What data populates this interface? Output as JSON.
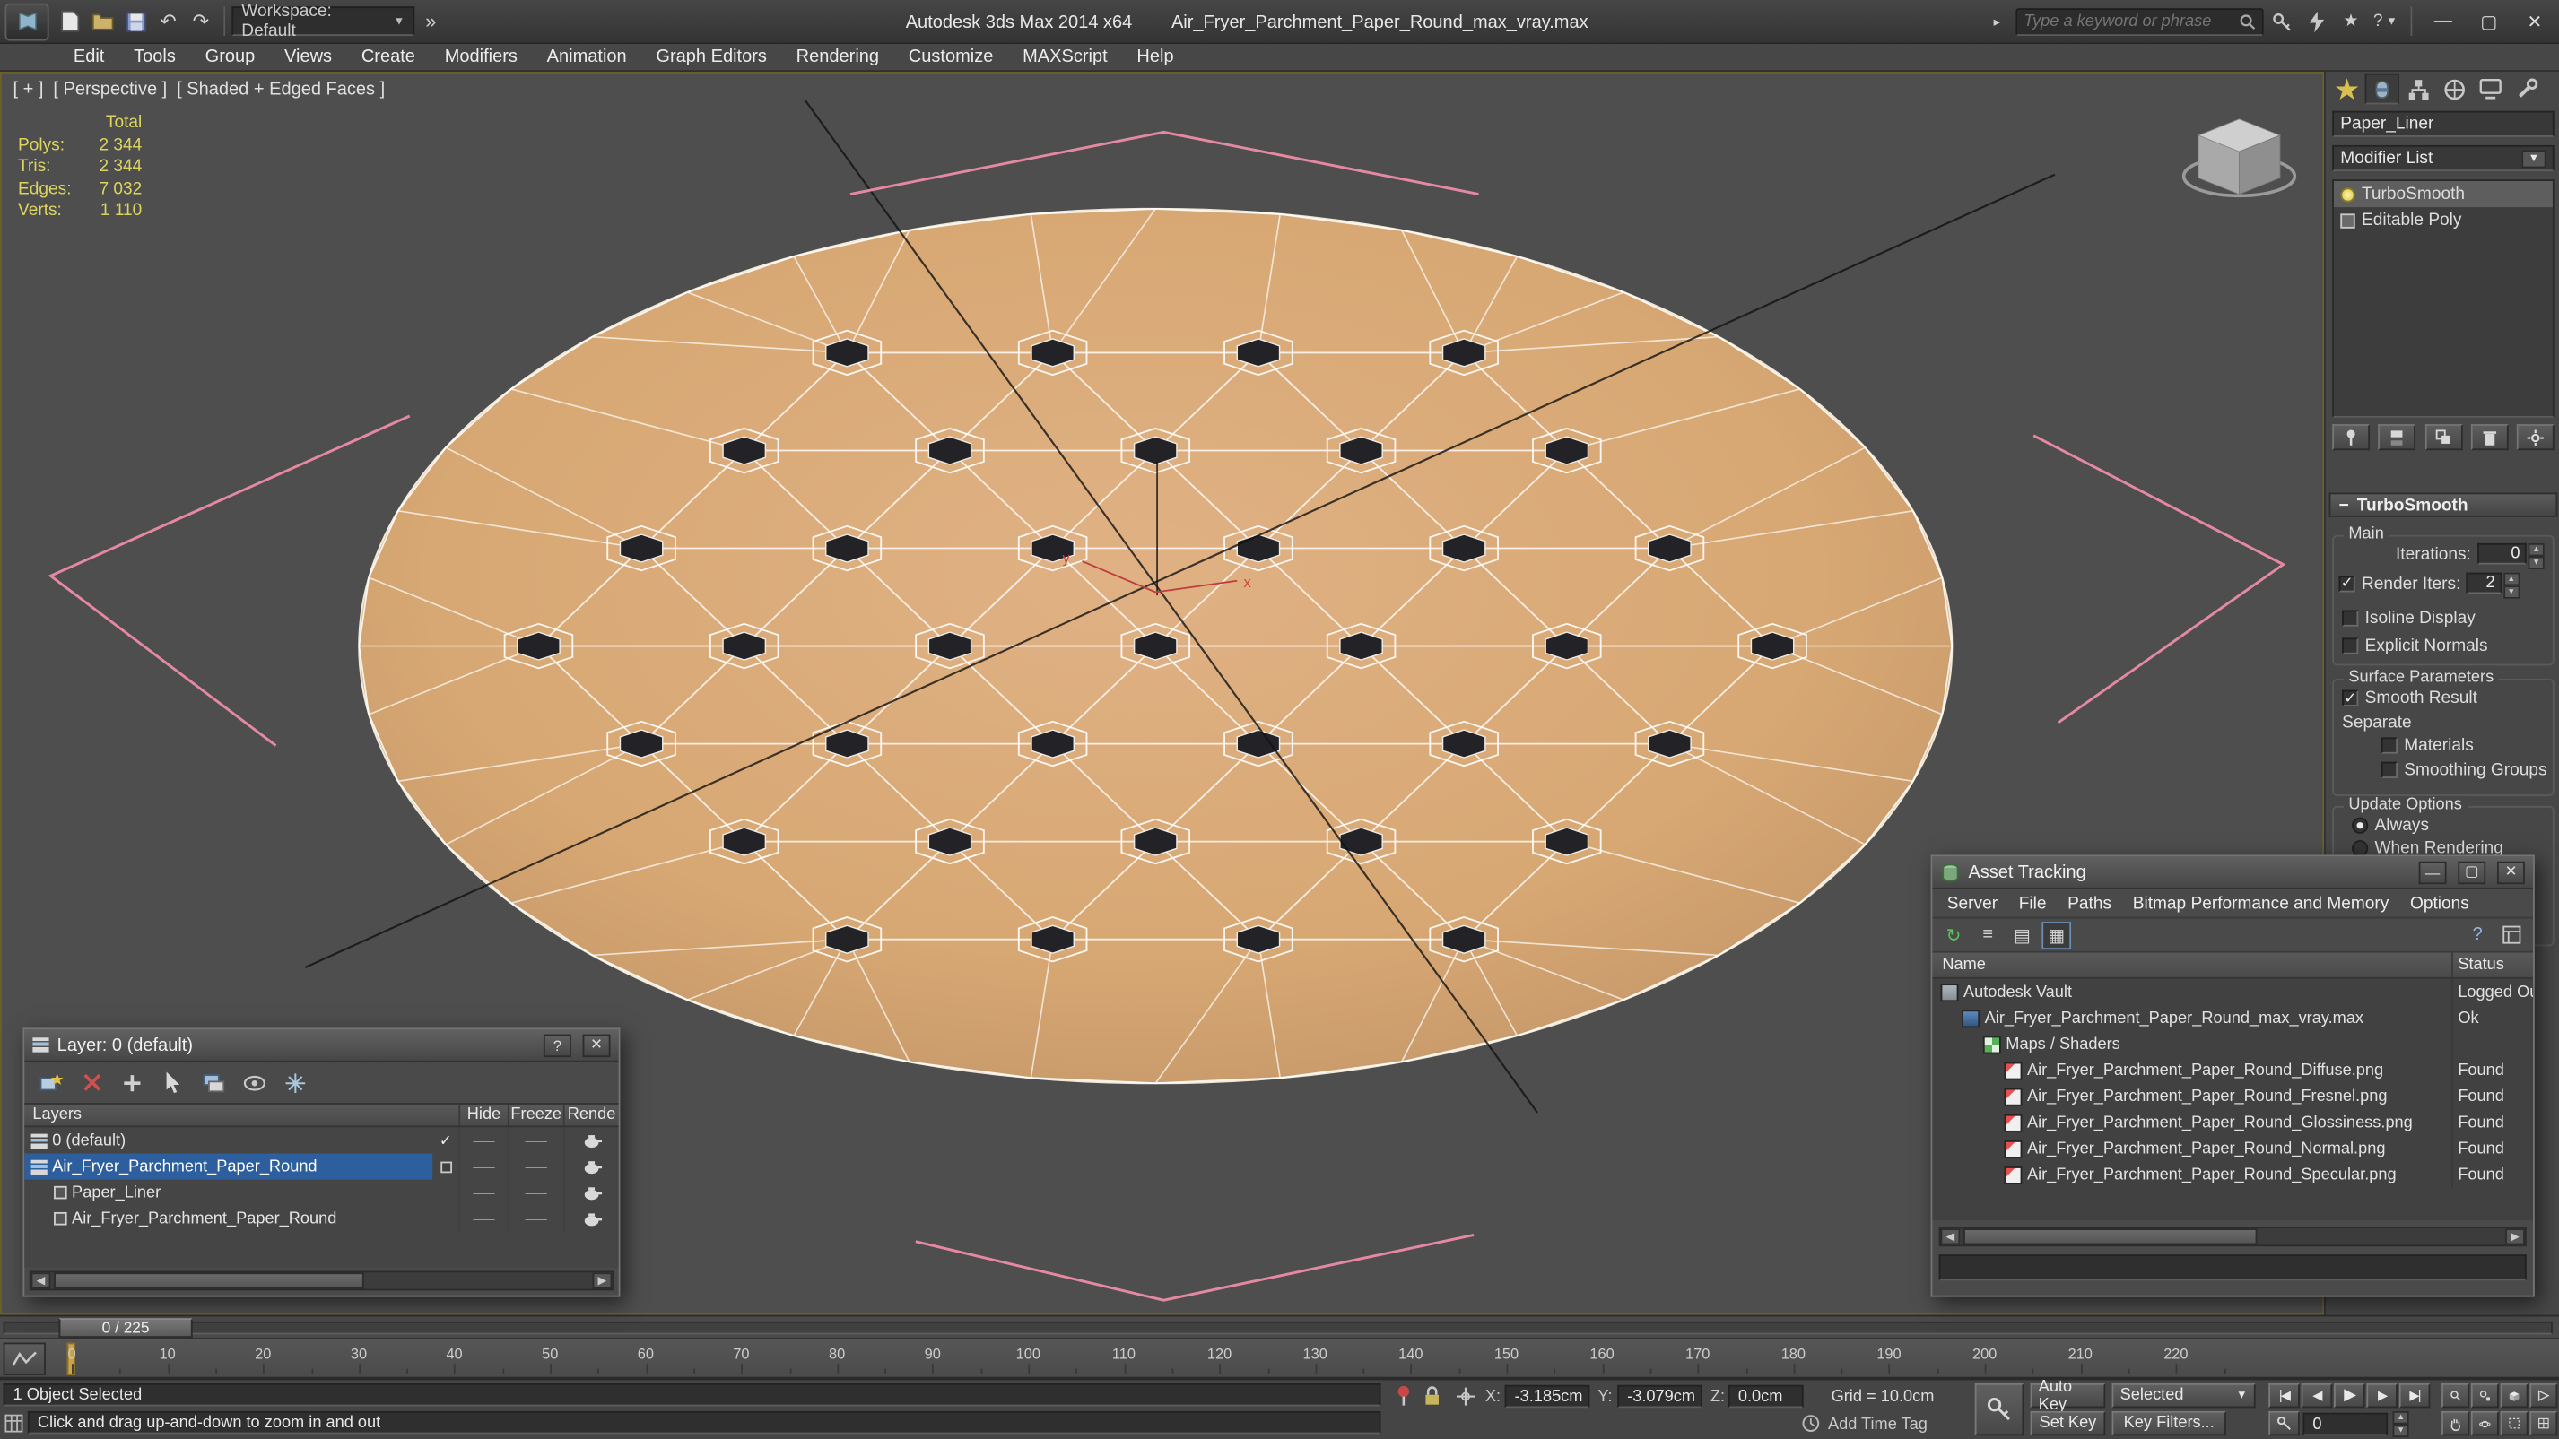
{
  "titlebar": {
    "workspace": "Workspace: Default",
    "app_title": "Autodesk 3ds Max  2014 x64",
    "doc_name": "Air_Fryer_Parchment_Paper_Round_max_vray.max",
    "search_placeholder": "Type a keyword or phrase"
  },
  "menubar": {
    "items": [
      "Edit",
      "Tools",
      "Group",
      "Views",
      "Create",
      "Modifiers",
      "Animation",
      "Graph Editors",
      "Rendering",
      "Customize",
      "MAXScript",
      "Help"
    ]
  },
  "viewport": {
    "menu_general": "[ + ]",
    "menu_pov": "[ Perspective ]",
    "menu_shading": "[ Shaded + Edged Faces ]",
    "stats": {
      "header": "Total",
      "rows": [
        {
          "label": "Polys:",
          "value": "2 344"
        },
        {
          "label": "Tris:",
          "value": "2 344"
        },
        {
          "label": "Edges:",
          "value": "7 032"
        },
        {
          "label": "Verts:",
          "value": "1 110"
        }
      ]
    },
    "axis_x_label": "x",
    "axis_y_label": "y"
  },
  "command_panel": {
    "object_name": "Paper_Liner",
    "modifier_list": "Modifier List",
    "stack": [
      {
        "name": "TurboSmooth",
        "selected": true
      },
      {
        "name": "Editable Poly",
        "selected": false
      }
    ],
    "rollout_title": "TurboSmooth",
    "groups": {
      "main": "Main",
      "surface": "Surface Parameters",
      "update": "Update Options"
    },
    "iterations_label": "Iterations:",
    "iterations_value": "0",
    "render_iters_label": "Render Iters:",
    "render_iters_value": "2",
    "isoline_label": "Isoline Display",
    "explicit_label": "Explicit Normals",
    "smooth_result_label": "Smooth Result",
    "separate_label": "Separate",
    "materials_label": "Materials",
    "smoothing_groups_label": "Smoothing Groups",
    "always_label": "Always",
    "when_rendering_label": "When Rendering"
  },
  "layer_dialog": {
    "title": "Layer: 0 (default)",
    "help_glyph": "?",
    "columns": [
      "Layers",
      "Hide",
      "Freeze",
      "Rende"
    ],
    "rows": [
      {
        "name": "0 (default)",
        "level": 0,
        "kind": "layer",
        "current": true,
        "selected": false
      },
      {
        "name": "Air_Fryer_Parchment_Paper_Round",
        "level": 0,
        "kind": "layer",
        "current": false,
        "selected": true
      },
      {
        "name": "Paper_Liner",
        "level": 1,
        "kind": "object",
        "current": false,
        "selected": false
      },
      {
        "name": "Air_Fryer_Parchment_Paper_Round",
        "level": 1,
        "kind": "object",
        "current": false,
        "selected": false
      }
    ]
  },
  "asset_tracking": {
    "title": "Asset Tracking",
    "menu": [
      "Server",
      "File",
      "Paths",
      "Bitmap Performance and Memory",
      "Options"
    ],
    "col_name": "Name",
    "col_status": "Status",
    "rows": [
      {
        "name": "Autodesk Vault",
        "status": "Logged Ou",
        "level": 0,
        "icon": "vault"
      },
      {
        "name": "Air_Fryer_Parchment_Paper_Round_max_vray.max",
        "status": "Ok",
        "level": 1,
        "icon": "max"
      },
      {
        "name": "Maps / Shaders",
        "status": "",
        "level": 2,
        "icon": "maps"
      },
      {
        "name": "Air_Fryer_Parchment_Paper_Round_Diffuse.png",
        "status": "Found",
        "level": 3,
        "icon": "png"
      },
      {
        "name": "Air_Fryer_Parchment_Paper_Round_Fresnel.png",
        "status": "Found",
        "level": 3,
        "icon": "png"
      },
      {
        "name": "Air_Fryer_Parchment_Paper_Round_Glossiness.png",
        "status": "Found",
        "level": 3,
        "icon": "png"
      },
      {
        "name": "Air_Fryer_Parchment_Paper_Round_Normal.png",
        "status": "Found",
        "level": 3,
        "icon": "png"
      },
      {
        "name": "Air_Fryer_Parchment_Paper_Round_Specular.png",
        "status": "Found",
        "level": 3,
        "icon": "png"
      }
    ]
  },
  "timeline": {
    "slider_label": "0 / 225",
    "tick_labels": [
      "0",
      "10",
      "20",
      "30",
      "40",
      "50",
      "60",
      "70",
      "80",
      "90",
      "100",
      "110",
      "120",
      "130",
      "140",
      "150",
      "160",
      "170",
      "180",
      "190",
      "200",
      "210",
      "220"
    ]
  },
  "statusbar": {
    "selection": "1 Object Selected",
    "prompt": "Click and drag up-and-down to zoom in and out",
    "x_label": "X:",
    "x_value": "-3.185cm",
    "y_label": "Y:",
    "y_value": "-3.079cm",
    "z_label": "Z:",
    "z_value": "0.0cm",
    "grid_label": "Grid = 10.0cm",
    "add_time_tag": "Add Time Tag",
    "auto_key": "Auto Key",
    "set_key": "Set Key",
    "key_mode_dropdown": "Selected",
    "key_filters": "Key Filters...",
    "frame_value": "0"
  },
  "colors": {
    "disc_fill": "#d7a873",
    "selection_blue": "#2d5e9e",
    "stats_yellow": "#ddd45e",
    "pink_helper": "#e589a2"
  }
}
